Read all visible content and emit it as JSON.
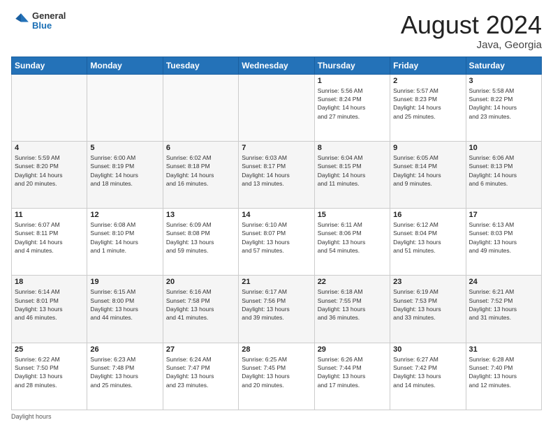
{
  "header": {
    "logo": {
      "general": "General",
      "blue": "Blue"
    },
    "month": "August 2024",
    "location": "Java, Georgia"
  },
  "days_of_week": [
    "Sunday",
    "Monday",
    "Tuesday",
    "Wednesday",
    "Thursday",
    "Friday",
    "Saturday"
  ],
  "weeks": [
    [
      {
        "day": "",
        "info": ""
      },
      {
        "day": "",
        "info": ""
      },
      {
        "day": "",
        "info": ""
      },
      {
        "day": "",
        "info": ""
      },
      {
        "day": "1",
        "info": "Sunrise: 5:56 AM\nSunset: 8:24 PM\nDaylight: 14 hours\nand 27 minutes."
      },
      {
        "day": "2",
        "info": "Sunrise: 5:57 AM\nSunset: 8:23 PM\nDaylight: 14 hours\nand 25 minutes."
      },
      {
        "day": "3",
        "info": "Sunrise: 5:58 AM\nSunset: 8:22 PM\nDaylight: 14 hours\nand 23 minutes."
      }
    ],
    [
      {
        "day": "4",
        "info": "Sunrise: 5:59 AM\nSunset: 8:20 PM\nDaylight: 14 hours\nand 20 minutes."
      },
      {
        "day": "5",
        "info": "Sunrise: 6:00 AM\nSunset: 8:19 PM\nDaylight: 14 hours\nand 18 minutes."
      },
      {
        "day": "6",
        "info": "Sunrise: 6:02 AM\nSunset: 8:18 PM\nDaylight: 14 hours\nand 16 minutes."
      },
      {
        "day": "7",
        "info": "Sunrise: 6:03 AM\nSunset: 8:17 PM\nDaylight: 14 hours\nand 13 minutes."
      },
      {
        "day": "8",
        "info": "Sunrise: 6:04 AM\nSunset: 8:15 PM\nDaylight: 14 hours\nand 11 minutes."
      },
      {
        "day": "9",
        "info": "Sunrise: 6:05 AM\nSunset: 8:14 PM\nDaylight: 14 hours\nand 9 minutes."
      },
      {
        "day": "10",
        "info": "Sunrise: 6:06 AM\nSunset: 8:13 PM\nDaylight: 14 hours\nand 6 minutes."
      }
    ],
    [
      {
        "day": "11",
        "info": "Sunrise: 6:07 AM\nSunset: 8:11 PM\nDaylight: 14 hours\nand 4 minutes."
      },
      {
        "day": "12",
        "info": "Sunrise: 6:08 AM\nSunset: 8:10 PM\nDaylight: 14 hours\nand 1 minute."
      },
      {
        "day": "13",
        "info": "Sunrise: 6:09 AM\nSunset: 8:08 PM\nDaylight: 13 hours\nand 59 minutes."
      },
      {
        "day": "14",
        "info": "Sunrise: 6:10 AM\nSunset: 8:07 PM\nDaylight: 13 hours\nand 57 minutes."
      },
      {
        "day": "15",
        "info": "Sunrise: 6:11 AM\nSunset: 8:06 PM\nDaylight: 13 hours\nand 54 minutes."
      },
      {
        "day": "16",
        "info": "Sunrise: 6:12 AM\nSunset: 8:04 PM\nDaylight: 13 hours\nand 51 minutes."
      },
      {
        "day": "17",
        "info": "Sunrise: 6:13 AM\nSunset: 8:03 PM\nDaylight: 13 hours\nand 49 minutes."
      }
    ],
    [
      {
        "day": "18",
        "info": "Sunrise: 6:14 AM\nSunset: 8:01 PM\nDaylight: 13 hours\nand 46 minutes."
      },
      {
        "day": "19",
        "info": "Sunrise: 6:15 AM\nSunset: 8:00 PM\nDaylight: 13 hours\nand 44 minutes."
      },
      {
        "day": "20",
        "info": "Sunrise: 6:16 AM\nSunset: 7:58 PM\nDaylight: 13 hours\nand 41 minutes."
      },
      {
        "day": "21",
        "info": "Sunrise: 6:17 AM\nSunset: 7:56 PM\nDaylight: 13 hours\nand 39 minutes."
      },
      {
        "day": "22",
        "info": "Sunrise: 6:18 AM\nSunset: 7:55 PM\nDaylight: 13 hours\nand 36 minutes."
      },
      {
        "day": "23",
        "info": "Sunrise: 6:19 AM\nSunset: 7:53 PM\nDaylight: 13 hours\nand 33 minutes."
      },
      {
        "day": "24",
        "info": "Sunrise: 6:21 AM\nSunset: 7:52 PM\nDaylight: 13 hours\nand 31 minutes."
      }
    ],
    [
      {
        "day": "25",
        "info": "Sunrise: 6:22 AM\nSunset: 7:50 PM\nDaylight: 13 hours\nand 28 minutes."
      },
      {
        "day": "26",
        "info": "Sunrise: 6:23 AM\nSunset: 7:48 PM\nDaylight: 13 hours\nand 25 minutes."
      },
      {
        "day": "27",
        "info": "Sunrise: 6:24 AM\nSunset: 7:47 PM\nDaylight: 13 hours\nand 23 minutes."
      },
      {
        "day": "28",
        "info": "Sunrise: 6:25 AM\nSunset: 7:45 PM\nDaylight: 13 hours\nand 20 minutes."
      },
      {
        "day": "29",
        "info": "Sunrise: 6:26 AM\nSunset: 7:44 PM\nDaylight: 13 hours\nand 17 minutes."
      },
      {
        "day": "30",
        "info": "Sunrise: 6:27 AM\nSunset: 7:42 PM\nDaylight: 13 hours\nand 14 minutes."
      },
      {
        "day": "31",
        "info": "Sunrise: 6:28 AM\nSunset: 7:40 PM\nDaylight: 13 hours\nand 12 minutes."
      }
    ]
  ],
  "footer": {
    "daylight_hours_label": "Daylight hours"
  }
}
